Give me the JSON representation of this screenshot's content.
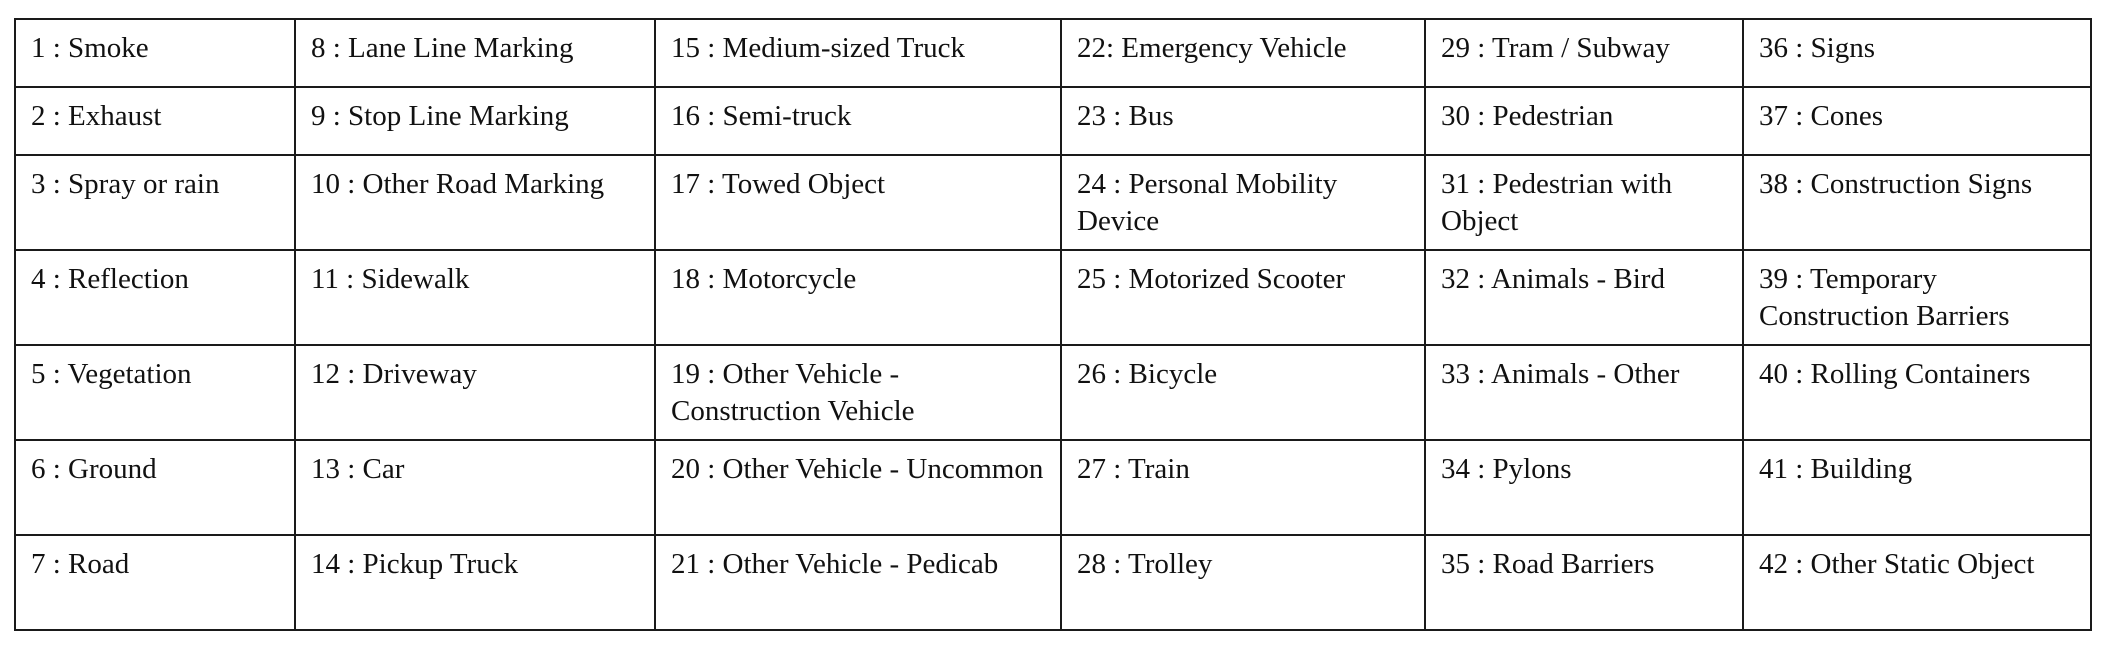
{
  "legend": {
    "rows": [
      [
        "1 : Smoke",
        "8 : Lane Line Marking",
        "15 : Medium-sized Truck",
        "22: Emergency Vehicle",
        "29 : Tram / Subway",
        "36 : Signs"
      ],
      [
        "2 : Exhaust",
        "9 : Stop Line Marking",
        "16 : Semi-truck",
        "23 : Bus",
        "30 : Pedestrian",
        "37 : Cones"
      ],
      [
        "3 : Spray or rain",
        "10 : Other Road Marking",
        "17 : Towed Object",
        "24 : Personal Mobility Device",
        "31 : Pedestrian with Object",
        "38 : Construction Signs"
      ],
      [
        "4 : Reflection",
        "11 : Sidewalk",
        "18 : Motorcycle",
        "25 : Motorized Scooter",
        "32 : Animals - Bird",
        "39 : Temporary Construction Barriers"
      ],
      [
        "5 : Vegetation",
        "12 : Driveway",
        "19 : Other Vehicle - Construction Vehicle",
        "26 : Bicycle",
        "33 : Animals - Other",
        "40 : Rolling Containers"
      ],
      [
        "6 : Ground",
        "13 : Car",
        "20 : Other Vehicle - Uncommon",
        "27 : Train",
        "34 : Pylons",
        "41 : Building"
      ],
      [
        "7 : Road",
        "14 : Pickup Truck",
        "21 : Other Vehicle - Pedicab",
        "28 : Trolley",
        "35 : Road Barriers",
        "42 : Other Static Object"
      ]
    ]
  }
}
